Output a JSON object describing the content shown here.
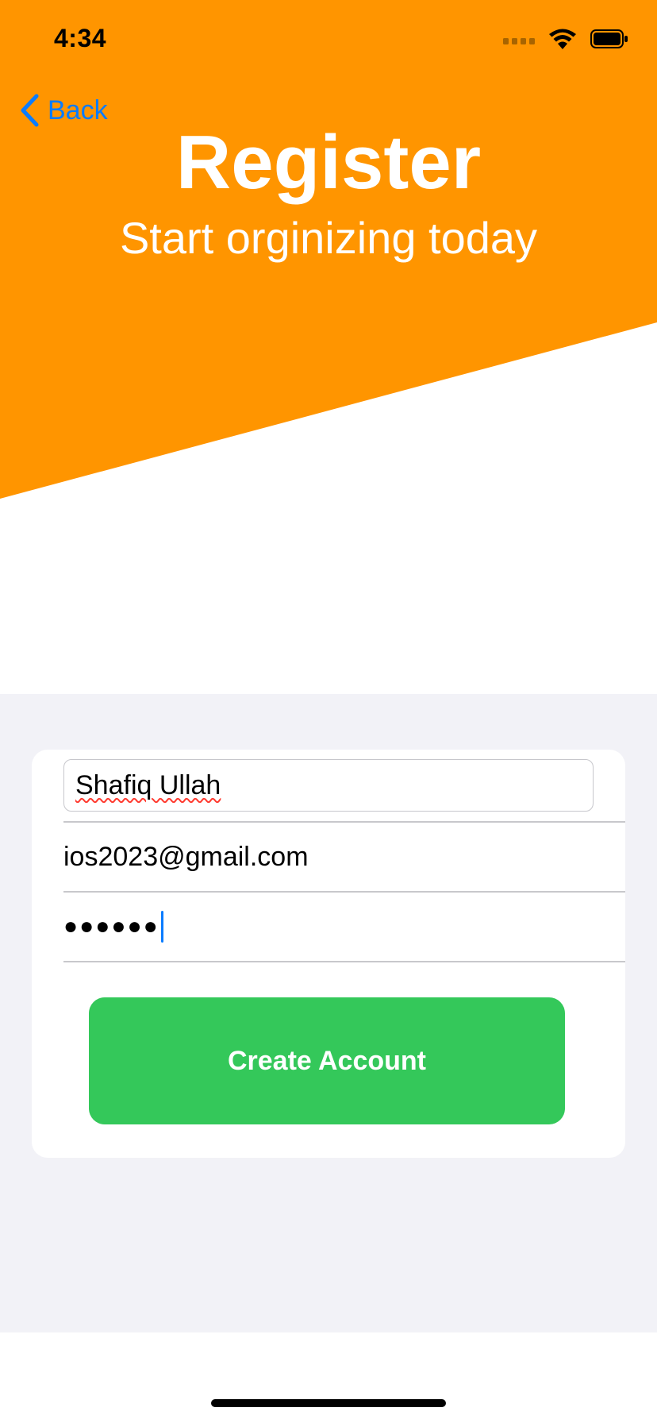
{
  "status_bar": {
    "time": "4:34",
    "icons": [
      "signal-icon",
      "wifi-icon",
      "battery-icon"
    ]
  },
  "nav": {
    "back_label": "Back",
    "back_icon": "chevron-left-icon"
  },
  "header": {
    "title": "Register",
    "subtitle": "Start orginizing today",
    "background_color": "#ff9500"
  },
  "form": {
    "name_value": "Shafiq Ullah",
    "email_value": "ios2023@gmail.com",
    "password_mask": "●●●●●●",
    "submit_label": "Create Account",
    "submit_color": "#34c85a"
  },
  "colors": {
    "accent": "#0a7cff",
    "form_background": "#f2f2f7"
  }
}
